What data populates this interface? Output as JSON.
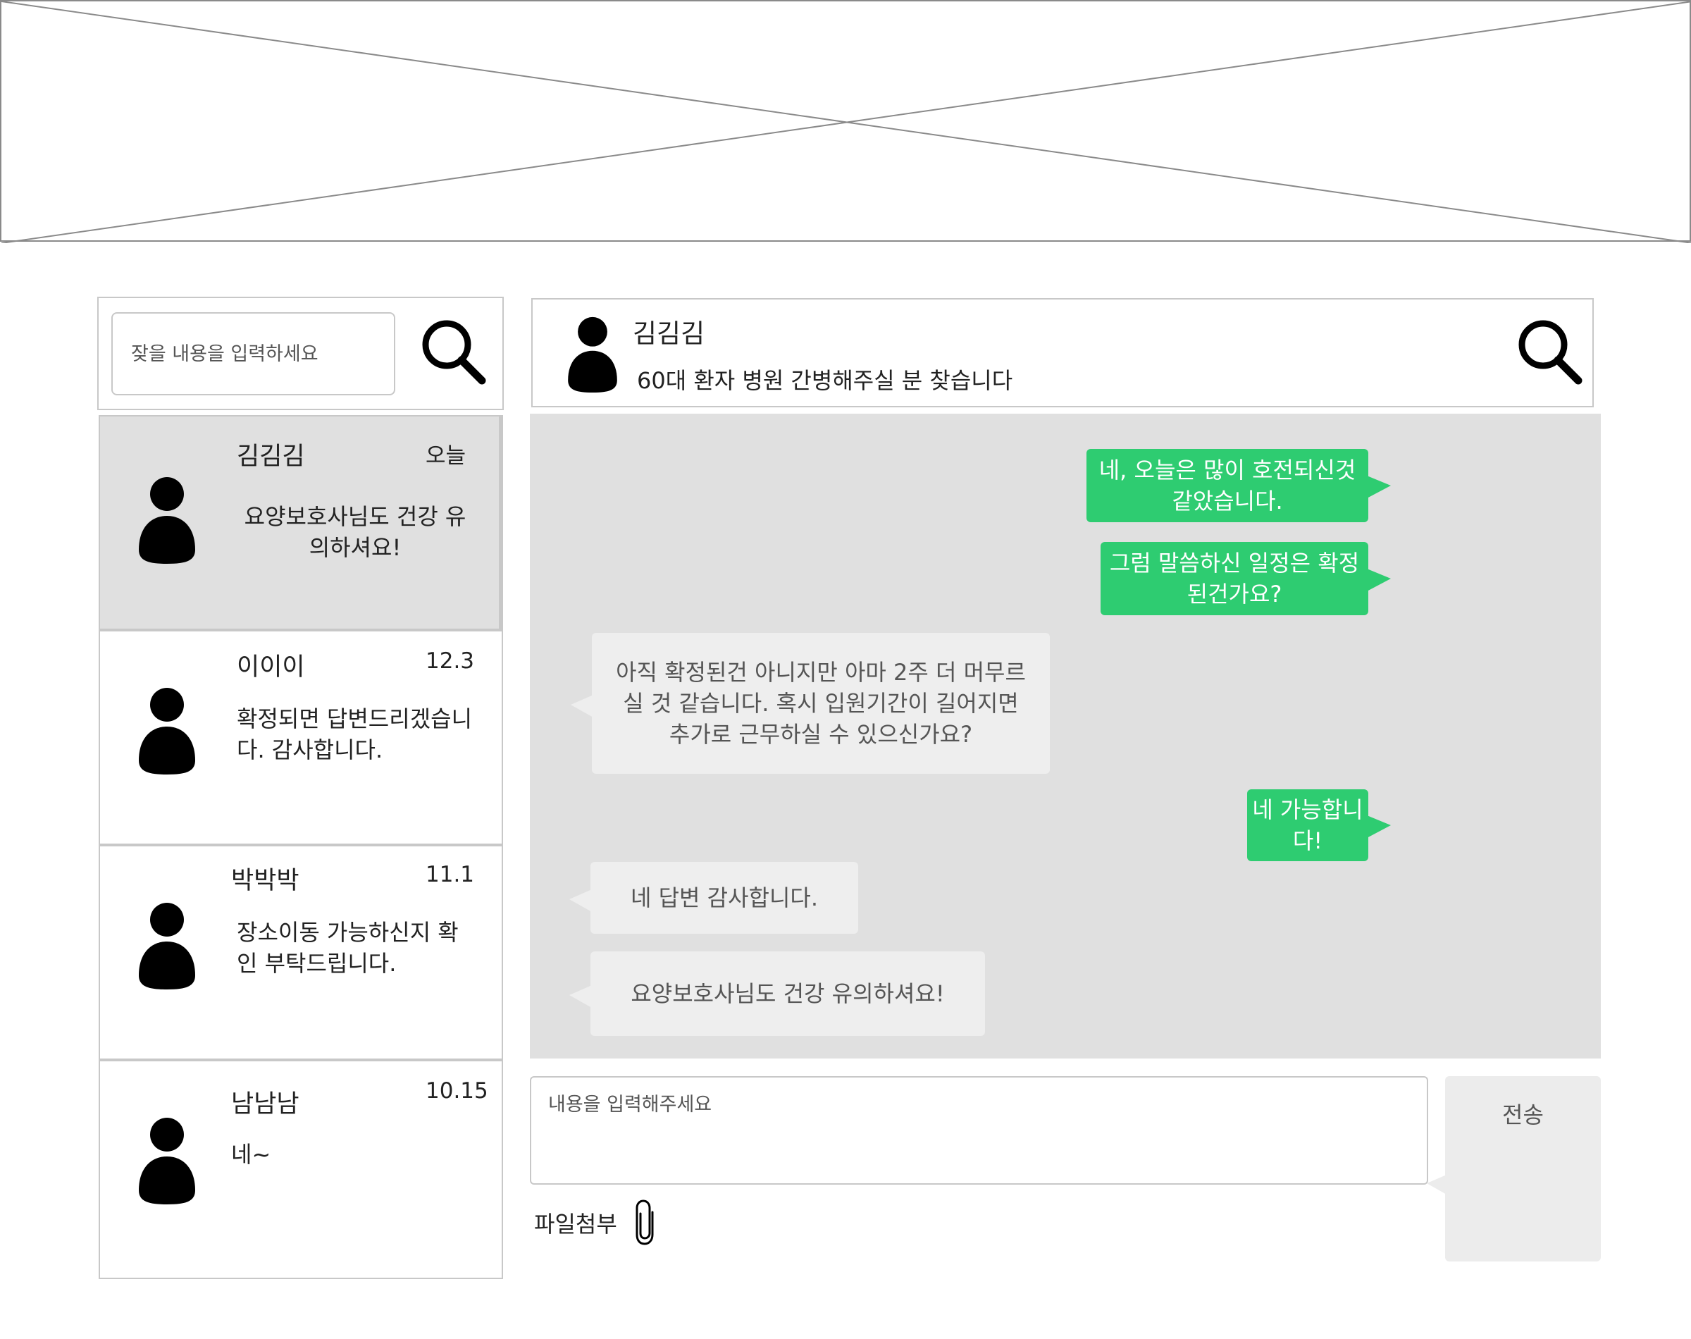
{
  "search": {
    "placeholder": "잦을 내용을 입력하세요"
  },
  "conversations": [
    {
      "name": "김김김",
      "date": "오늘",
      "preview": "요양보호사님도 건강 유의하셔요!"
    },
    {
      "name": "이이이",
      "date": "12.3",
      "preview": "확정되면 답변드리겠습니다. 감사합니다."
    },
    {
      "name": "박박박",
      "date": "11.1",
      "preview": "장소이동 가능하신지 확인 부탁드립니다."
    },
    {
      "name": "남남남",
      "date": "10.15",
      "preview": "네~"
    }
  ],
  "chat": {
    "name": "김김김",
    "subtitle": "60대 환자 병원 간병해주실 분 찾습니다",
    "messages": [
      {
        "direction": "out",
        "text": "네, 오늘은 많이 호전되신것 같았습니다."
      },
      {
        "direction": "out",
        "text": "그럼 말씀하신 일정은 확정된건가요?"
      },
      {
        "direction": "in",
        "text": "아직 확정된건 아니지만 아마 2주 더 머무르실 것 같습니다. 혹시 입원기간이 길어지면 추가로 근무하실 수 있으신가요?"
      },
      {
        "direction": "out",
        "text": "네 가능합니다!"
      },
      {
        "direction": "in",
        "text": "네 답변 감사합니다."
      },
      {
        "direction": "in",
        "text": "요양보호사님도 건강 유의하셔요!"
      }
    ]
  },
  "composer": {
    "placeholder": "내용을 입력해주세요",
    "send_label": "전송",
    "attach_label": "파일첨부"
  },
  "colors": {
    "outgoing_bubble": "#2ecc71",
    "incoming_bubble": "#eeeeee",
    "chat_background": "#e0e0e0",
    "active_conversation": "#e0e0e0"
  },
  "icons": {
    "search": "search-icon",
    "avatar": "user-avatar-icon",
    "attach": "paperclip-icon"
  }
}
